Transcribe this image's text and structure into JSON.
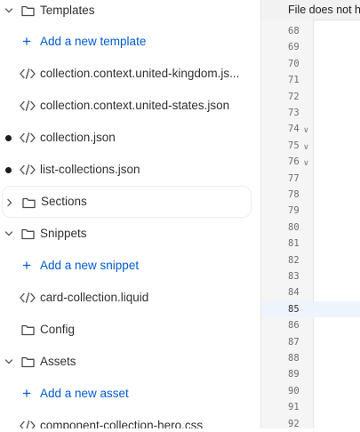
{
  "sidebar": {
    "templates_label": "Templates",
    "add_template_label": "Add a new template",
    "files_templates": [
      "collection.context.united-kingdom.js...",
      "collection.context.united-states.json",
      "collection.json",
      "list-collections.json"
    ],
    "sections_label": "Sections",
    "snippets_label": "Snippets",
    "add_snippet_label": "Add a new snippet",
    "snippet_file": "card-collection.liquid",
    "config_label": "Config",
    "assets_label": "Assets",
    "add_asset_label": "Add a new asset",
    "asset_file": "component-collection-hero.css"
  },
  "editor": {
    "banner_text": "File does not h",
    "line_numbers": [
      "68",
      "69",
      "70",
      "71",
      "72",
      "73",
      "74",
      "75",
      "76",
      "77",
      "78",
      "79",
      "80",
      "81",
      "82",
      "83",
      "84",
      "85",
      "86",
      "87",
      "88",
      "89",
      "90",
      "91",
      "92"
    ],
    "active_line": "85"
  }
}
